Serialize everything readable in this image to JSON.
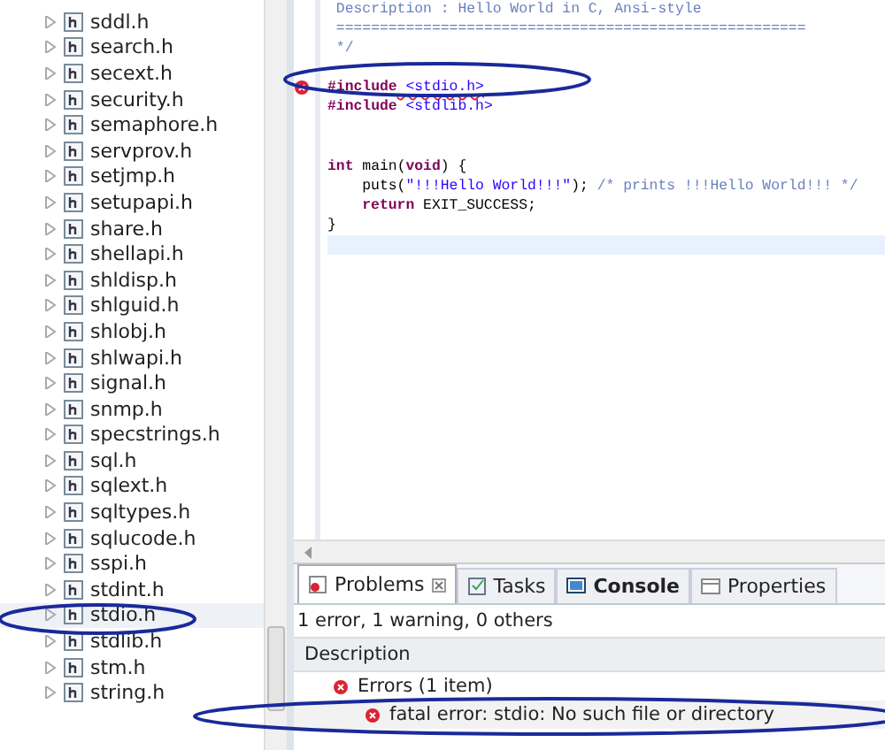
{
  "tree": {
    "items": [
      {
        "name": "sddl.h",
        "selected": false
      },
      {
        "name": "search.h",
        "selected": false
      },
      {
        "name": "secext.h",
        "selected": false
      },
      {
        "name": "security.h",
        "selected": false
      },
      {
        "name": "semaphore.h",
        "selected": false
      },
      {
        "name": "servprov.h",
        "selected": false
      },
      {
        "name": "setjmp.h",
        "selected": false
      },
      {
        "name": "setupapi.h",
        "selected": false
      },
      {
        "name": "share.h",
        "selected": false
      },
      {
        "name": "shellapi.h",
        "selected": false
      },
      {
        "name": "shldisp.h",
        "selected": false
      },
      {
        "name": "shlguid.h",
        "selected": false
      },
      {
        "name": "shlobj.h",
        "selected": false
      },
      {
        "name": "shlwapi.h",
        "selected": false
      },
      {
        "name": "signal.h",
        "selected": false
      },
      {
        "name": "snmp.h",
        "selected": false
      },
      {
        "name": "specstrings.h",
        "selected": false
      },
      {
        "name": "sql.h",
        "selected": false
      },
      {
        "name": "sqlext.h",
        "selected": false
      },
      {
        "name": "sqltypes.h",
        "selected": false
      },
      {
        "name": "sqlucode.h",
        "selected": false
      },
      {
        "name": "sspi.h",
        "selected": false
      },
      {
        "name": "stdint.h",
        "selected": false
      },
      {
        "name": "stdio.h",
        "selected": true
      },
      {
        "name": "stdlib.h",
        "selected": false
      },
      {
        "name": "stm.h",
        "selected": false
      },
      {
        "name": "string.h",
        "selected": false
      }
    ]
  },
  "editor": {
    "lines": [
      {
        "kind": "code",
        "error": false,
        "indented": false,
        "tokens": [
          {
            "kind": "comment",
            "text": " Description : Hello World in C, Ansi-style"
          }
        ]
      },
      {
        "kind": "code",
        "error": false,
        "indented": false,
        "tokens": [
          {
            "kind": "comment",
            "text": " ======================================================"
          }
        ]
      },
      {
        "kind": "code",
        "error": false,
        "indented": false,
        "tokens": [
          {
            "kind": "comment",
            "text": " */"
          }
        ]
      },
      {
        "kind": "blank",
        "error": false
      },
      {
        "kind": "code",
        "error": true,
        "indented": false,
        "tokens": [
          {
            "kind": "keyword",
            "text": "#include"
          },
          {
            "kind": "header",
            "text": " <stdio.h>"
          }
        ]
      },
      {
        "kind": "code",
        "error": false,
        "indented": false,
        "tokens": [
          {
            "kind": "keyword",
            "text": "#include"
          },
          {
            "kind": "header",
            "text": " <stdlib.h>"
          }
        ]
      },
      {
        "kind": "blank",
        "error": false
      },
      {
        "kind": "blank",
        "error": false
      },
      {
        "kind": "code",
        "error": false,
        "indented": false,
        "tokens": [
          {
            "kind": "keyword",
            "text": "int"
          },
          {
            "kind": "plain",
            "text": " main("
          },
          {
            "kind": "keyword",
            "text": "void"
          },
          {
            "kind": "plain",
            "text": ") {"
          }
        ]
      },
      {
        "kind": "code",
        "error": false,
        "indented": true,
        "tokens": [
          {
            "kind": "plain",
            "text": "puts("
          },
          {
            "kind": "string",
            "text": "\"!!!Hello World!!!\""
          },
          {
            "kind": "plain",
            "text": "); "
          },
          {
            "kind": "comment",
            "text": "/* prints !!!Hello World!!! */"
          }
        ]
      },
      {
        "kind": "code",
        "error": false,
        "indented": true,
        "tokens": [
          {
            "kind": "keyword",
            "text": "return"
          },
          {
            "kind": "plain",
            "text": " EXIT_SUCCESS;"
          }
        ]
      },
      {
        "kind": "code",
        "error": false,
        "indented": false,
        "tokens": [
          {
            "kind": "plain",
            "text": "}"
          }
        ]
      }
    ]
  },
  "problems": {
    "tabs": [
      {
        "label": "Problems",
        "kind": "problems",
        "selected": true
      },
      {
        "label": "Tasks",
        "kind": "tasks",
        "selected": false
      },
      {
        "label": "Console",
        "kind": "console",
        "selected": false
      },
      {
        "label": "Properties",
        "kind": "properties",
        "selected": false
      }
    ],
    "summary": "1 error, 1 warning, 0 others",
    "column": "Description",
    "groups": [
      {
        "label": "Errors (1 item)",
        "children": [
          {
            "label": "fatal error: stdio: No such file or directory"
          }
        ]
      }
    ]
  }
}
